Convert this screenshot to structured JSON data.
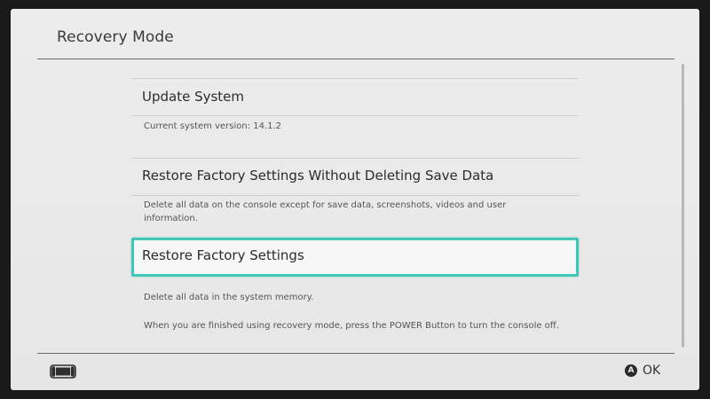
{
  "header": {
    "title": "Recovery Mode"
  },
  "options": [
    {
      "label": "Update System",
      "description": "Current system version: 14.1.2"
    },
    {
      "label": "Restore Factory Settings Without Deleting Save Data",
      "description": "Delete all data on the console except for save data, screenshots, videos and user information."
    },
    {
      "label": "Restore Factory Settings",
      "description": "Delete all data in the system memory.",
      "selected": true
    }
  ],
  "footer": {
    "note": "When you are finished using recovery mode, press the POWER Button to turn the console off.",
    "ok_button_glyph": "A",
    "ok_label": "OK"
  },
  "colors": {
    "selection_border": "#3fc8b8",
    "background": "#ececec",
    "text": "#2c2c2c"
  },
  "icons": {
    "bottom_left": "handheld-console-icon",
    "ok_button": "a-button-icon"
  }
}
